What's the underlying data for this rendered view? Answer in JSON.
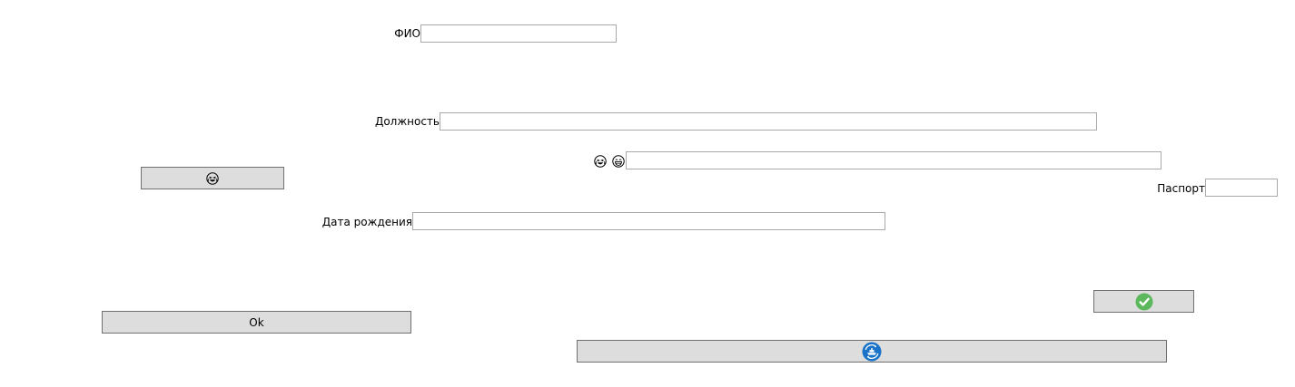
{
  "form": {
    "fio": {
      "label": "ФИО",
      "value": ""
    },
    "position": {
      "label": "Должность",
      "value": ""
    },
    "emoji_field": {
      "icons": [
        "crying-laughing-face-icon",
        "grinning-face-icon"
      ],
      "value": ""
    },
    "passport": {
      "label": "Паспорт",
      "value": ""
    },
    "birth_date": {
      "label": "Дата рождения",
      "value": ""
    }
  },
  "buttons": {
    "emoji_button": {
      "icon": "crying-laughing-face-icon"
    },
    "ok_button": {
      "label": "Ok"
    },
    "confirm_button": {
      "icon": "checkmark-circle-icon",
      "color": "#5cb85c"
    },
    "ship_button": {
      "icon": "ship-refresh-icon",
      "color": "#1a73c8"
    }
  }
}
